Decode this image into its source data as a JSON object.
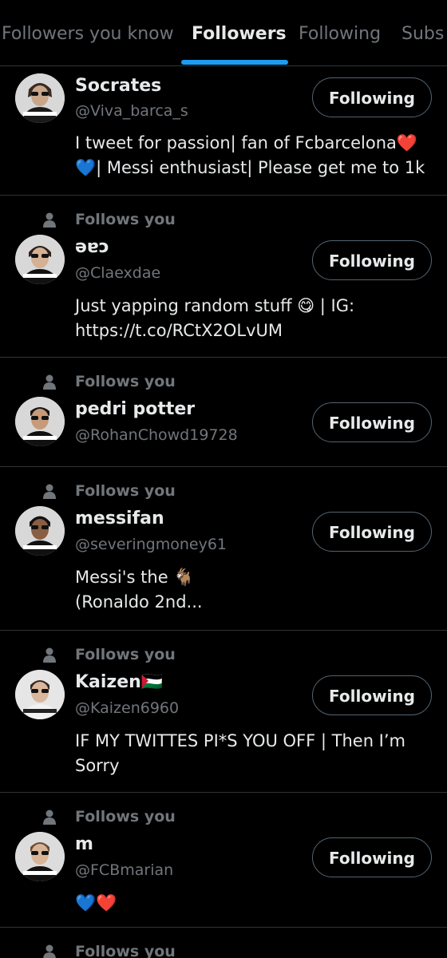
{
  "tabs": [
    {
      "label": "Followers you know",
      "active": false
    },
    {
      "label": "Followers",
      "active": true
    },
    {
      "label": "Following",
      "active": false
    },
    {
      "label": "Subs",
      "active": false
    }
  ],
  "colors": {
    "background": "#000000",
    "accent": "#1d9bf0",
    "secondary_text": "#71767b",
    "primary_text": "#e7e9ea"
  },
  "follows_you_label": "Follows you",
  "users": [
    {
      "name": "Socrates",
      "handle": "@Viva_barca_s",
      "bio": "I tweet for passion| fan of Fcbarcelona❤️💙| Messi enthusiast| Please get me to 1k",
      "button": "Following",
      "follows_you": false
    },
    {
      "name": "əɐɔ",
      "handle": "@Claexdae",
      "bio": "Just yapping random stuff 😋 | IG: https://t.co/RCtX2OLvUM",
      "button": "Following",
      "follows_you": true
    },
    {
      "name": "pedri potter",
      "handle": "@RohanChowd19728",
      "bio": "",
      "button": "Following",
      "follows_you": true
    },
    {
      "name": "messifan",
      "handle": "@severingmoney61",
      "bio": "Messi's the 🐐 (Ronaldo 2nd...",
      "button": "Following",
      "follows_you": true
    },
    {
      "name": "Kaizen🇵🇸",
      "handle": "@Kaizen6960",
      "bio": "IF MY TWITTES PI*S YOU OFF | Then I’m Sorry",
      "button": "Following",
      "follows_you": true
    },
    {
      "name": "m",
      "handle": "@FCBmarian",
      "bio": "💙❤️",
      "button": "Following",
      "follows_you": true
    },
    {
      "name": "",
      "handle": "",
      "bio": "",
      "button": "",
      "follows_you": true
    }
  ]
}
